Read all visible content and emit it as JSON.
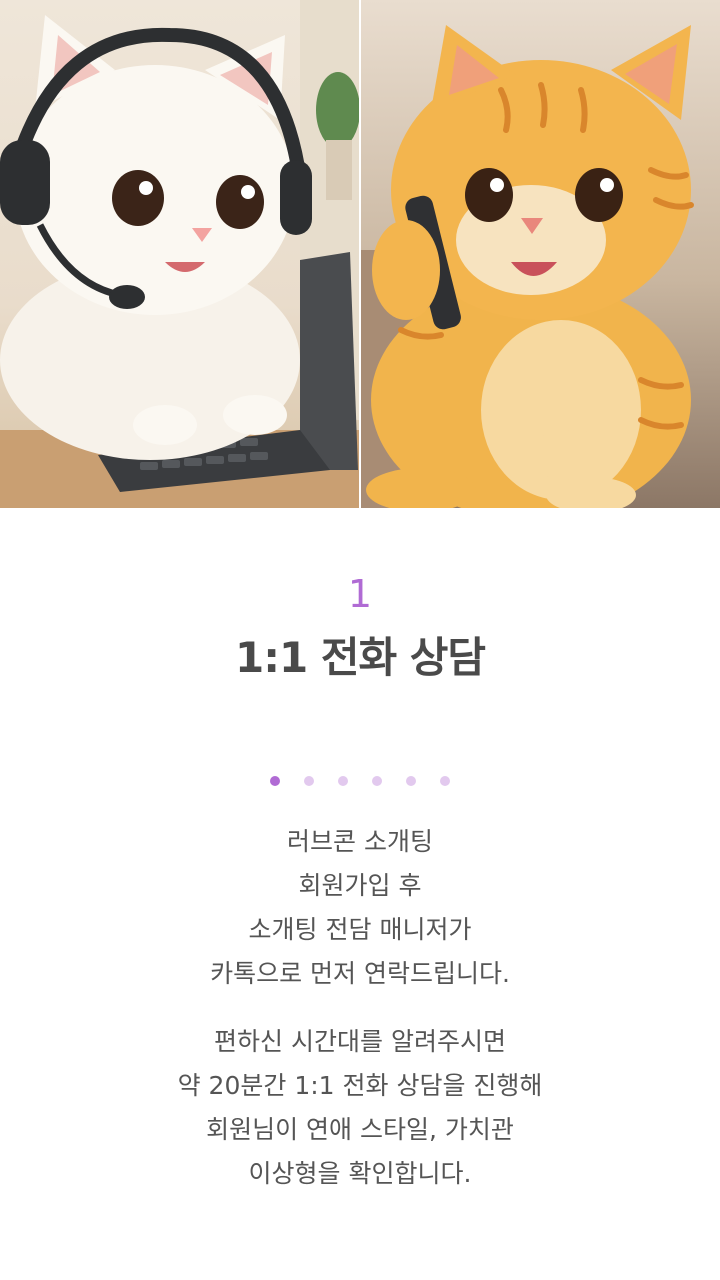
{
  "hero": {
    "left_image": "white-kitten-with-headset-at-computer",
    "right_image": "orange-tabby-kitten-on-phone"
  },
  "step": {
    "number": "1",
    "title": "1:1 전화 상담"
  },
  "pagination": {
    "total": 6,
    "active_index": 0
  },
  "description": {
    "paragraph1": [
      "러브콘 소개팅",
      "회원가입 후",
      "소개팅 전담 매니저가",
      "카톡으로 먼저 연락드립니다."
    ],
    "paragraph2": [
      "편하신 시간대를 알려주시면",
      "약 20분간 1:1 전화 상담을 진행해",
      "회원님이 연애 스타일, 가치관",
      "이상형을 확인합니다."
    ]
  },
  "colors": {
    "accent": "#b06bd4",
    "dot_inactive": "#e2c9ee",
    "title": "#4a4a4a",
    "body_text": "#555555"
  }
}
